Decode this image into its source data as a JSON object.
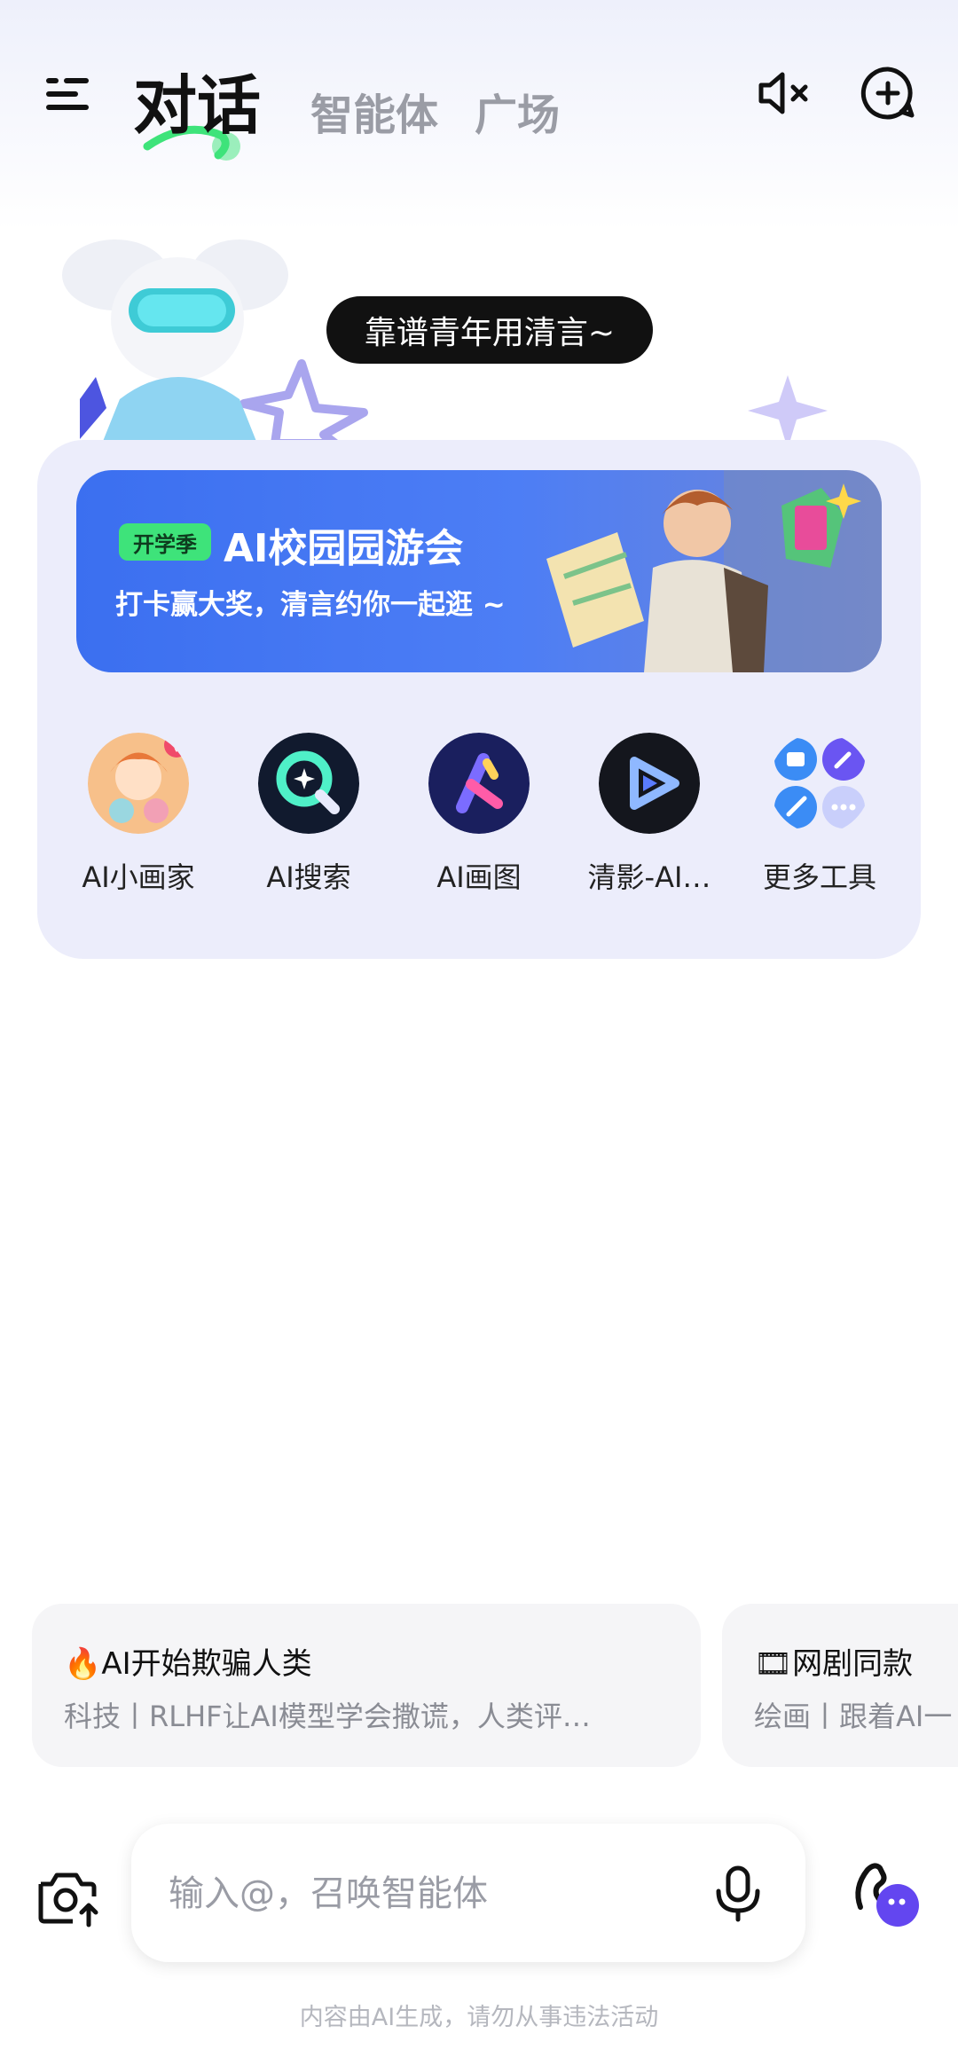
{
  "header": {
    "tabs": [
      {
        "label": "对话",
        "active": true
      },
      {
        "label": "智能体",
        "active": false
      },
      {
        "label": "广场",
        "active": false
      }
    ],
    "icons": [
      "menu-icon",
      "mute-icon",
      "new-chat-icon"
    ]
  },
  "mascot": {
    "speech": "靠谱青年用清言~"
  },
  "banner": {
    "badge": "开学季",
    "title": "AI校园园游会",
    "subtitle": "打卡赢大奖，清言约你一起逛 ~"
  },
  "tools": [
    {
      "label": "AI小画家",
      "icon": "ai-painter-icon"
    },
    {
      "label": "AI搜索",
      "icon": "ai-search-icon"
    },
    {
      "label": "AI画图",
      "icon": "ai-draw-icon"
    },
    {
      "label": "清影-AI…",
      "icon": "qingying-video-icon"
    },
    {
      "label": "更多工具",
      "icon": "more-tools-icon"
    }
  ],
  "suggestions": [
    {
      "emoji": "🔥",
      "title": "AI开始欺骗人类",
      "desc": "科技丨RLHF让AI模型学会撒谎，人类评…"
    },
    {
      "emoji": "🎞",
      "title": "网剧同款",
      "desc": "绘画丨跟着AI一"
    }
  ],
  "input": {
    "placeholder": "输入@，召唤智能体"
  },
  "footer": {
    "note": "内容由AI生成，请勿从事违法活动"
  },
  "colors": {
    "accent": "#5b5cf0",
    "banner_blue": "#3b6ff0",
    "card_bg": "#ecedfb",
    "badge_green": "#3ee37a"
  }
}
